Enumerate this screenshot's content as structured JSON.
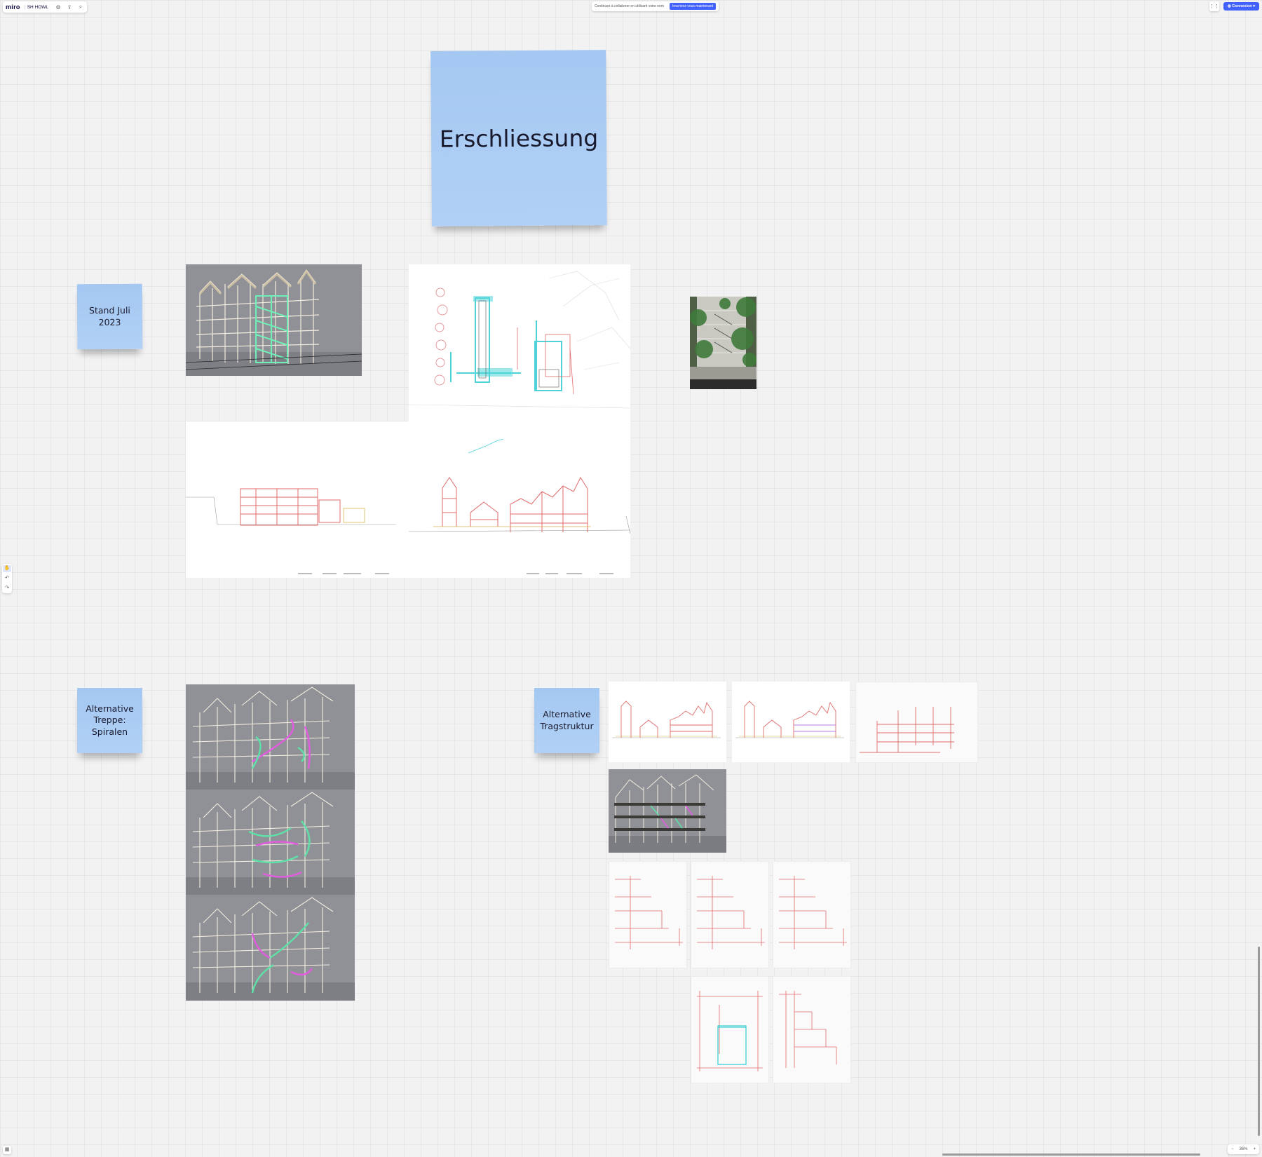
{
  "app": {
    "logo": "miro",
    "board_name": "SH HOWL",
    "icons": {
      "settings": "gear-icon",
      "upload": "upload-icon",
      "search": "search-icon"
    }
  },
  "banner": {
    "text": "Continuez à collaborer en utilisant votre nom",
    "button": "Inscrivez-vous maintenant"
  },
  "topright": {
    "apps_icon": "grid-icon",
    "share_label": "Connexion",
    "share_icon": "globe-icon"
  },
  "toolbar": {
    "select_icon": "hand-icon",
    "undo_icon": "undo-icon",
    "redo_icon": "redo-icon"
  },
  "stickies": {
    "title": "Erschliessung",
    "stand_line1": "Stand Juli",
    "stand_line2": "2023",
    "treppe_line1": "Alternative",
    "treppe_line2": "Treppe:",
    "treppe_line3": "Spiralen",
    "trag_line1": "Alternative",
    "trag_line2": "Tragstruktur"
  },
  "colors": {
    "sticky": "#a9cbf3",
    "accent": "#4262ff",
    "render_bg": "#8f9196",
    "drawing_red": "#e06a6a",
    "stair_green": "#5fe0a8",
    "stair_magenta": "#e25ce0",
    "stair_cyan": "#3ed0d6"
  },
  "bottom": {
    "frames_icon": "frames-icon",
    "zoom_out": "−",
    "zoom_level": "36%",
    "zoom_in": "+"
  }
}
